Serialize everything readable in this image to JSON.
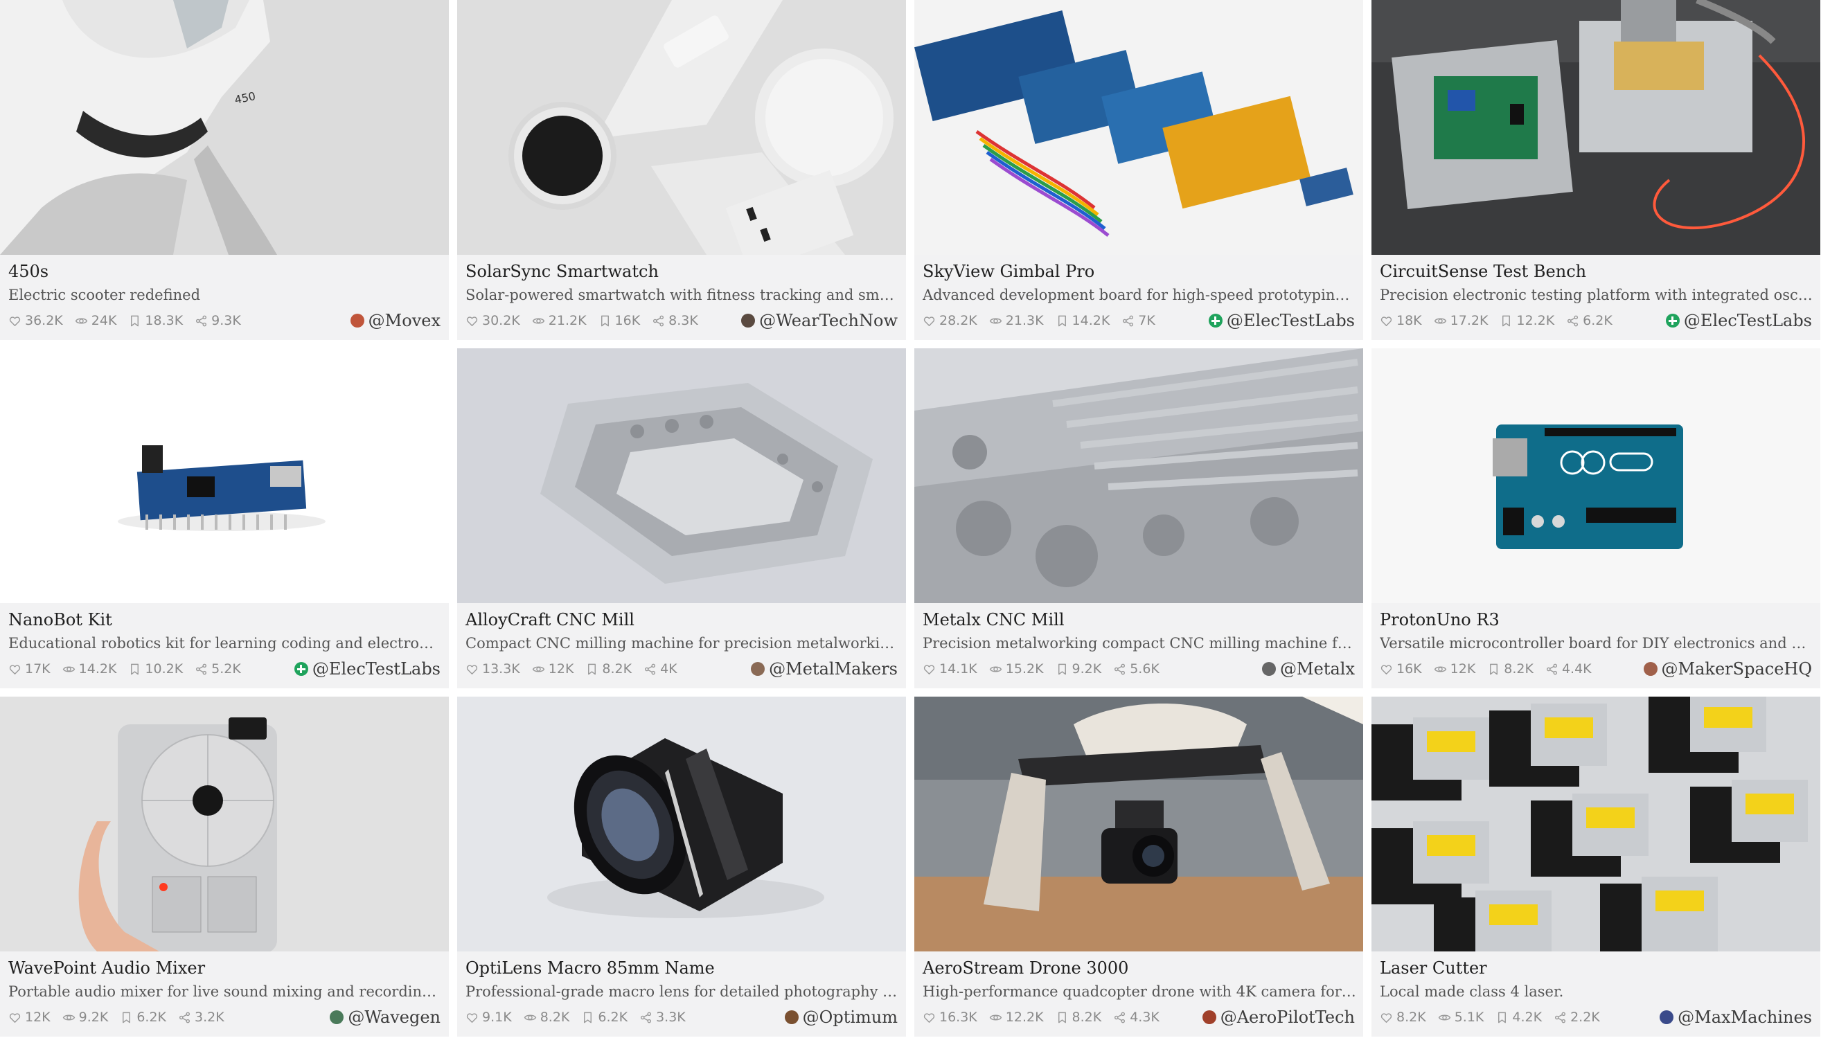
{
  "cards": [
    {
      "title": "450s",
      "description": "Electric scooter redefined",
      "likes": "36.2K",
      "views": "24K",
      "saves": "18.3K",
      "shares": "9.3K",
      "author": "@Movex",
      "avatar_color": "#c0553a",
      "avatar_type": "photo",
      "image": "white-scooter"
    },
    {
      "title": "SolarSync Smartwatch",
      "description": "Solar-powered smartwatch with fitness tracking and smartp...",
      "likes": "30.2K",
      "views": "21.2K",
      "saves": "16K",
      "shares": "8.3K",
      "author": "@WearTechNow",
      "avatar_color": "#5a4a40",
      "avatar_type": "photo",
      "image": "white-smartwatch"
    },
    {
      "title": "SkyView Gimbal Pro",
      "description": "Advanced development board for high-speed prototyping ...",
      "likes": "28.2K",
      "views": "21.3K",
      "saves": "14.2K",
      "shares": "7K",
      "author": "@ElecTestLabs",
      "avatar_color": "#1fa35c",
      "avatar_type": "plus",
      "image": "dev-boards"
    },
    {
      "title": "CircuitSense Test Bench",
      "description": "Precision electronic testing platform with integrated oscillos...",
      "likes": "18K",
      "views": "17.2K",
      "saves": "12.2K",
      "shares": "6.2K",
      "author": "@ElecTestLabs",
      "avatar_color": "#1fa35c",
      "avatar_type": "plus",
      "image": "test-bench"
    },
    {
      "title": "NanoBot Kit",
      "description": "Educational robotics kit for learning coding and electronics...",
      "likes": "17K",
      "views": "14.2K",
      "saves": "10.2K",
      "shares": "5.2K",
      "author": "@ElecTestLabs",
      "avatar_color": "#1fa35c",
      "avatar_type": "plus",
      "image": "nano-board"
    },
    {
      "title": "AlloyCraft CNC Mill",
      "description": "Compact CNC milling machine for precision metalworking a...",
      "likes": "13.3K",
      "views": "12K",
      "saves": "8.2K",
      "shares": "4K",
      "author": "@MetalMakers",
      "avatar_color": "#8a6a55",
      "avatar_type": "photo",
      "image": "cnc-housing"
    },
    {
      "title": "Metalx CNC Mill",
      "description": "Precision metalworking compact CNC milling machine for pre...",
      "likes": "14.1K",
      "views": "15.2K",
      "saves": "9.2K",
      "shares": "5.6K",
      "author": "@Metalx",
      "avatar_color": "#666666",
      "avatar_type": "photo",
      "image": "cnc-block"
    },
    {
      "title": "ProtonUno R3",
      "description": "Versatile microcontroller board for DIY electronics and educa...",
      "likes": "16K",
      "views": "12K",
      "saves": "8.2K",
      "shares": "4.4K",
      "author": "@MakerSpaceHQ",
      "avatar_color": "#a0604a",
      "avatar_type": "photo",
      "image": "uno-board"
    },
    {
      "title": "WavePoint Audio Mixer",
      "description": "Portable audio mixer for live sound mixing and recording w...",
      "likes": "12K",
      "views": "9.2K",
      "saves": "6.2K",
      "shares": "3.2K",
      "author": "@Wavegen",
      "avatar_color": "#4a7a5a",
      "avatar_type": "photo",
      "image": "audio-device"
    },
    {
      "title": "OptiLens Macro 85mm Name",
      "description": "Professional-grade macro lens for detailed photography and...",
      "likes": "9.1K",
      "views": "8.2K",
      "saves": "6.2K",
      "shares": "3.3K",
      "author": "@Optimum",
      "avatar_color": "#7a5030",
      "avatar_type": "photo",
      "image": "camera-lens"
    },
    {
      "title": "AeroStream Drone 3000",
      "description": "High-performance quadcopter drone with 4K camera for aer...",
      "likes": "16.3K",
      "views": "12.2K",
      "saves": "8.2K",
      "shares": "4.3K",
      "author": "@AeroPilotTech",
      "avatar_color": "#a0402a",
      "avatar_type": "photo",
      "image": "drone"
    },
    {
      "title": "Laser Cutter",
      "description": "Local made class 4 laser.",
      "likes": "8.2K",
      "views": "5.1K",
      "saves": "4.2K",
      "shares": "2.2K",
      "author": "@MaxMachines",
      "avatar_color": "#3a4a8a",
      "avatar_type": "photo",
      "image": "laser-modules"
    }
  ]
}
